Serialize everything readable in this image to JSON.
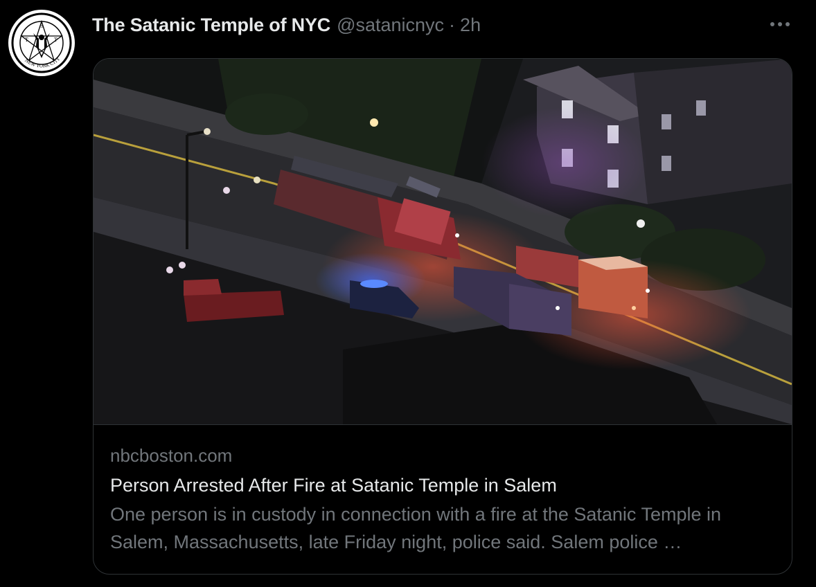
{
  "tweet": {
    "author": {
      "display_name": "The Satanic Temple of NYC",
      "handle": "@satanicnyc",
      "avatar_icon": "satanic-temple-nyc-logo-icon",
      "avatar_text": "NEW YORK CITY"
    },
    "separator": "·",
    "time": "2h",
    "more_icon": "more-horizontal-icon",
    "card": {
      "domain": "nbcboston.com",
      "title": "Person Arrested After Fire at Satanic Temple in Salem",
      "description": "One person is in custody in connection with a fire at the Satanic Temple in Salem, Massachusetts, late Friday night, police said. Salem police …",
      "image": "aerial-night-fire-trucks-photo"
    }
  },
  "colors": {
    "background": "#000000",
    "primary_text": "#e7e9ea",
    "secondary_text": "#71767b",
    "border": "#2f3336"
  }
}
